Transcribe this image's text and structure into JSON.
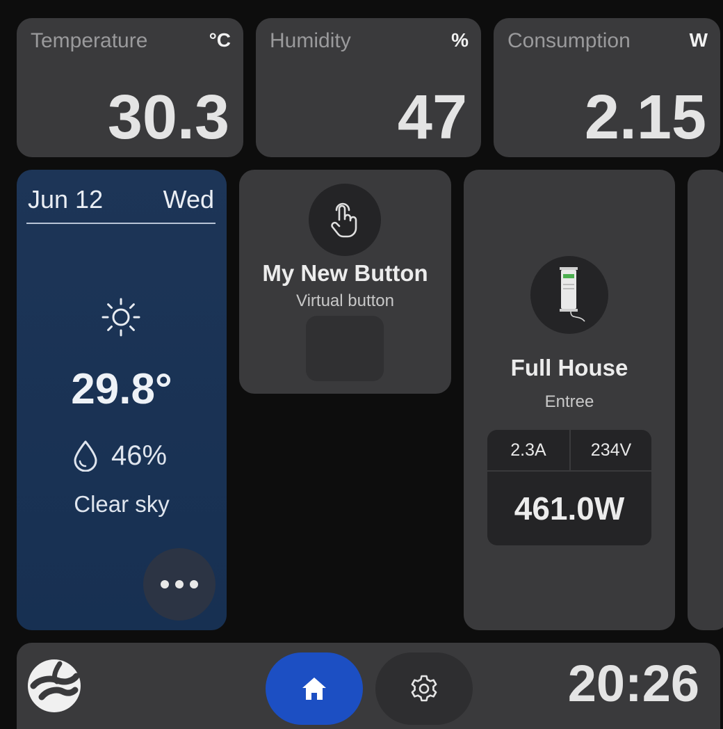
{
  "sensors": [
    {
      "label": "Temperature",
      "unit": "°C",
      "value": "30.3"
    },
    {
      "label": "Humidity",
      "unit": "%",
      "value": "47"
    },
    {
      "label": "Consumption",
      "unit": "W",
      "value": "2.15"
    }
  ],
  "weather": {
    "date": "Jun 12",
    "day": "Wed",
    "icon": "sun-icon",
    "temperature": "29.8°",
    "humidity": "46%",
    "condition": "Clear sky",
    "background_color": "#1d3557"
  },
  "virtual_button": {
    "icon": "hand-pointer-icon",
    "title": "My New Button",
    "subtitle": "Virtual button"
  },
  "energy_meter": {
    "icon": "din-rail-meter-icon",
    "title": "Full House",
    "subtitle": "Entree",
    "current": "2.3A",
    "voltage": "234V",
    "power": "461.0W"
  },
  "bottom_bar": {
    "logo": "s-logo-icon",
    "home_icon": "home-icon",
    "settings_icon": "gear-icon",
    "time": "20:26",
    "accent_color": "#1c4fc3"
  }
}
